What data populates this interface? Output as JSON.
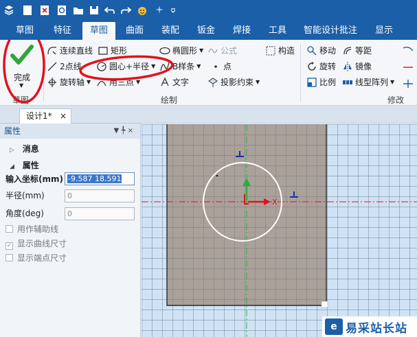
{
  "quick_access": {
    "icons": [
      "app-menu-icon",
      "new-file-icon",
      "save-icon",
      "undo-icon",
      "redo-icon",
      "smile-icon",
      "dropdown-icon"
    ]
  },
  "tabs": [
    "草图",
    "特征",
    "草图",
    "曲面",
    "装配",
    "钣金",
    "焊接",
    "工具",
    "智能设计批注",
    "显示"
  ],
  "active_tab_index": 2,
  "ribbon": {
    "finish_label": "完成",
    "finish_group_label": "草图",
    "draw": {
      "polyline": "连续直线",
      "rectangle": "矩形",
      "ellipse": "椭圆形",
      "formula": "公式",
      "construct": "构造",
      "two_point_line": "2点线",
      "circle_center_radius": "圆心+半径",
      "bspline": "B样条",
      "point": "点",
      "rotate_axis": "旋转轴",
      "three_point_arc": "用三点",
      "text": "文字",
      "project": "投影约束",
      "group_label": "绘制"
    },
    "modify": {
      "move": "移动",
      "offset": "等距",
      "rotate": "旋转",
      "mirror": "镜像",
      "scale": "比例",
      "linear_pattern": "线型阵列",
      "group_label": "修改"
    }
  },
  "document": {
    "tab_label": "设计1*",
    "close_symbol": "×"
  },
  "properties": {
    "title": "属性",
    "pin_symbol": "▼ ╄ ×",
    "sections": {
      "message": "消息",
      "properties": "属性"
    },
    "fields": {
      "coord_label": "输入坐标(mm)",
      "coord_value": "-9.587 18.591",
      "radius_label": "半径(mm)",
      "radius_value": "0",
      "angle_label": "角度(deg)",
      "angle_value": "0"
    },
    "checkboxes": [
      {
        "label": "用作辅助线",
        "checked": false
      },
      {
        "label": "显示曲线尺寸",
        "checked": true
      },
      {
        "label": "显示端点尺寸",
        "checked": false
      }
    ]
  },
  "canvas": {
    "x_axis_label": "X",
    "marker_symbol": "⊥"
  },
  "watermark": {
    "logo": "e",
    "text": "易采站长站"
  },
  "colors": {
    "ribbon_blue": "#1b5fa8",
    "annotation_red": "#e3121b",
    "sketch_plane": "#a89b92",
    "grid_bg": "#cfe3f5",
    "grid_line": "#3c5060"
  }
}
